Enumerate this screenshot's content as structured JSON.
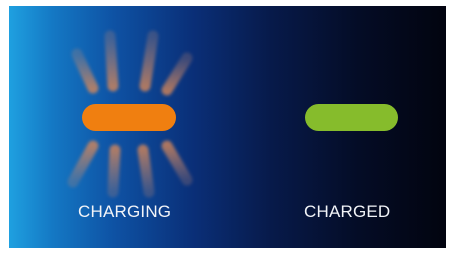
{
  "status_labels": {
    "charging": "CHARGING",
    "charged": "CHARGED"
  },
  "colors": {
    "charging_indicator": "#f07f10",
    "charged_indicator": "#86bc2c",
    "background_left": "#1fa0e0",
    "background_right": "#02040f",
    "label_text": "#f2f4f8"
  },
  "icons": {
    "charging": "pulsing-orange-pill-with-rays",
    "charged": "steady-green-pill"
  }
}
